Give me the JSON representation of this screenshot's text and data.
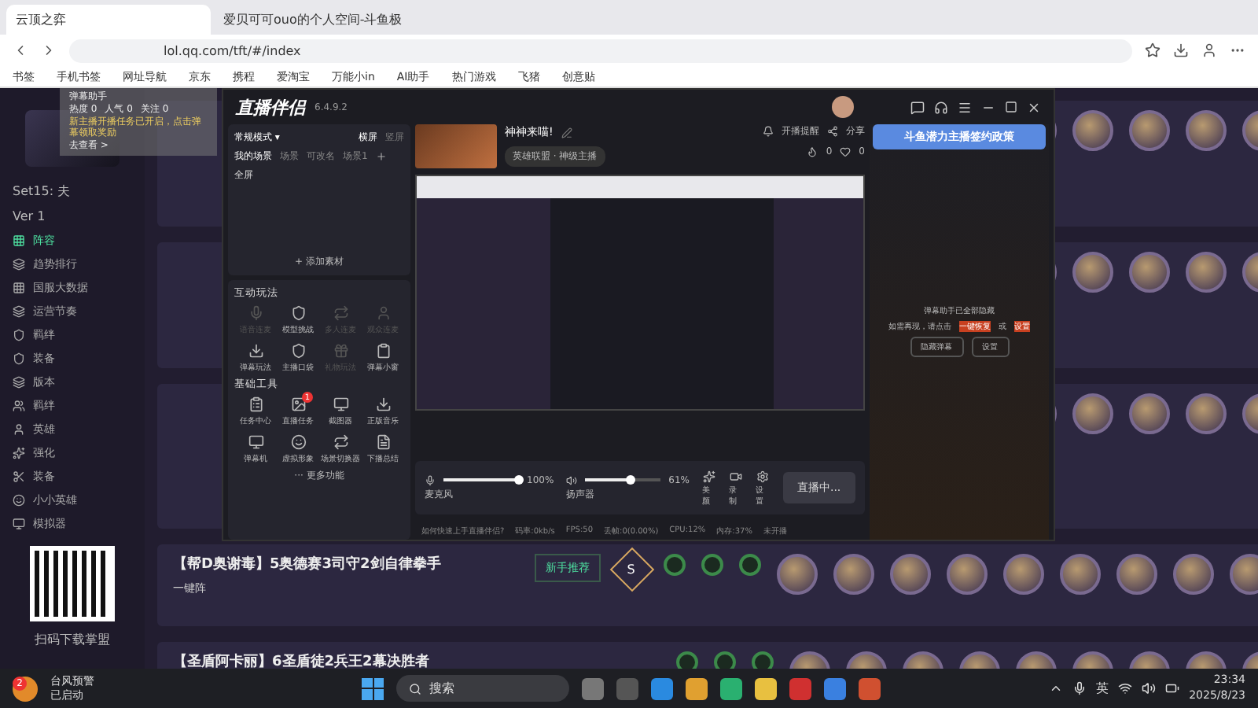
{
  "browser": {
    "tabs": [
      {
        "title": "云顶之弈",
        "selected": true
      },
      {
        "title": "爱贝可可ouo的个人空间-斗鱼极",
        "selected": false
      }
    ],
    "address": "lol.qq.com/tft/#/index",
    "bookmarks": [
      "书签",
      "手机书签",
      "网址导航",
      "京东",
      "携程",
      "爱淘宝",
      "万能小in",
      "AI助手",
      "热门游戏",
      "飞猪",
      "创意贴"
    ]
  },
  "site": {
    "set_label": "Set15: 夫",
    "version_label": "Ver 1",
    "nav": [
      {
        "label": "阵容",
        "selected": true
      },
      {
        "label": "趋势排行",
        "selected": false
      },
      {
        "label": "国服大数据",
        "selected": false
      },
      {
        "label": "运营节奏",
        "selected": false
      },
      {
        "label": "羁绊",
        "selected": false
      },
      {
        "label": "装备",
        "selected": false
      },
      {
        "label": "版本",
        "selected": false
      },
      {
        "label": "羁绊",
        "selected": false
      },
      {
        "label": "英雄",
        "selected": false
      },
      {
        "label": "强化",
        "selected": false
      },
      {
        "label": "装备",
        "selected": false
      },
      {
        "label": "小小英雄",
        "selected": false
      },
      {
        "label": "模拟器",
        "selected": false
      }
    ],
    "qr_caption": "扫码下载掌盟",
    "rows": [
      {
        "title": "",
        "badge": ""
      },
      {
        "title": "",
        "badge": ""
      },
      {
        "title": "",
        "badge": ""
      },
      {
        "title": "【帮D奥谢毒】5奥德赛3司守2剑自律拳手",
        "subtitle": "一键阵",
        "tier": "S",
        "badge": "新手推荐"
      },
      {
        "title": "【圣盾阿卡丽】6圣盾徒2兵王2幕决胜者",
        "badge": ""
      }
    ]
  },
  "danmu_panel": {
    "title": "弹幕助手",
    "stats": [
      "热度 0",
      "人气 0",
      "关注 0"
    ],
    "notice": "新主播开播任务已开启，点击弹幕领取奖励",
    "link": "去查看 >"
  },
  "streamer_app": {
    "name": "直播伴侣",
    "version": "6.4.9.2",
    "modes": {
      "current": "常规模式 ▾",
      "orientations": [
        {
          "label": "横屏",
          "selected": true
        },
        {
          "label": "竖屏",
          "selected": false
        }
      ]
    },
    "scene_tabs": [
      {
        "label": "我的场景",
        "selected": true
      },
      {
        "label": "场景",
        "selected": false
      },
      {
        "label": "可改名",
        "selected": false
      },
      {
        "label": "场景1",
        "selected": false
      }
    ],
    "sources": [
      "全屏"
    ],
    "add_source": "+ 添加素材",
    "sections": [
      {
        "title": "互动玩法",
        "tools": [
          {
            "label": "语音连麦",
            "disabled": true
          },
          {
            "label": "模型挑战",
            "disabled": false
          },
          {
            "label": "多人连麦",
            "disabled": true
          },
          {
            "label": "观众连麦",
            "disabled": true
          },
          {
            "label": "弹幕玩法",
            "disabled": false
          },
          {
            "label": "主播口袋",
            "disabled": false
          },
          {
            "label": "礼物玩法",
            "disabled": true
          },
          {
            "label": "弹幕小窗",
            "disabled": false
          }
        ]
      },
      {
        "title": "基础工具",
        "tools": [
          {
            "label": "任务中心",
            "disabled": false
          },
          {
            "label": "直播任务",
            "disabled": false,
            "badge": "1"
          },
          {
            "label": "截图器",
            "disabled": false
          },
          {
            "label": "正版音乐",
            "disabled": false
          },
          {
            "label": "弹幕机",
            "disabled": false
          },
          {
            "label": "虚拟形象",
            "disabled": false
          },
          {
            "label": "场景切换器",
            "disabled": false
          },
          {
            "label": "下播总结",
            "disabled": false
          }
        ]
      }
    ],
    "more": "··· 更多功能",
    "room": {
      "title": "神神来喵!",
      "category": "英雄联盟 · 神级主播",
      "remind": "开播提醒",
      "share": "分享",
      "likes": "0",
      "follows": "0"
    },
    "audio": [
      {
        "label": "麦克风",
        "level": 1,
        "reading": "100%"
      },
      {
        "label": "扬声器",
        "level": 0.61,
        "reading": "61%"
      }
    ],
    "actions": [
      "美颜",
      "录制",
      "设置"
    ],
    "live_button": "直播中...",
    "status": {
      "help": "如何快速上手直播伴侣?",
      "items": [
        "码率:0kb/s",
        "FPS:50",
        "丢帧:0(0.00%)",
        "CPU:12%",
        "内存:37%",
        "未开播"
      ]
    },
    "banner": "斗鱼潜力主播签约政策",
    "danmu_notice": {
      "line1": "弹幕助手已全部隐藏",
      "line2": "如需再现，请点击",
      "restore": "一键恢复",
      "or": "或",
      "settings": "设置",
      "buttons": [
        "隐藏弹幕",
        "设置"
      ]
    }
  },
  "taskbar": {
    "weather_badge": "2",
    "weather_title": "台风预警",
    "weather_sub": "已启动",
    "search": "搜索",
    "tray_language": "英",
    "time": "23:34",
    "date": "2025/8/23"
  }
}
